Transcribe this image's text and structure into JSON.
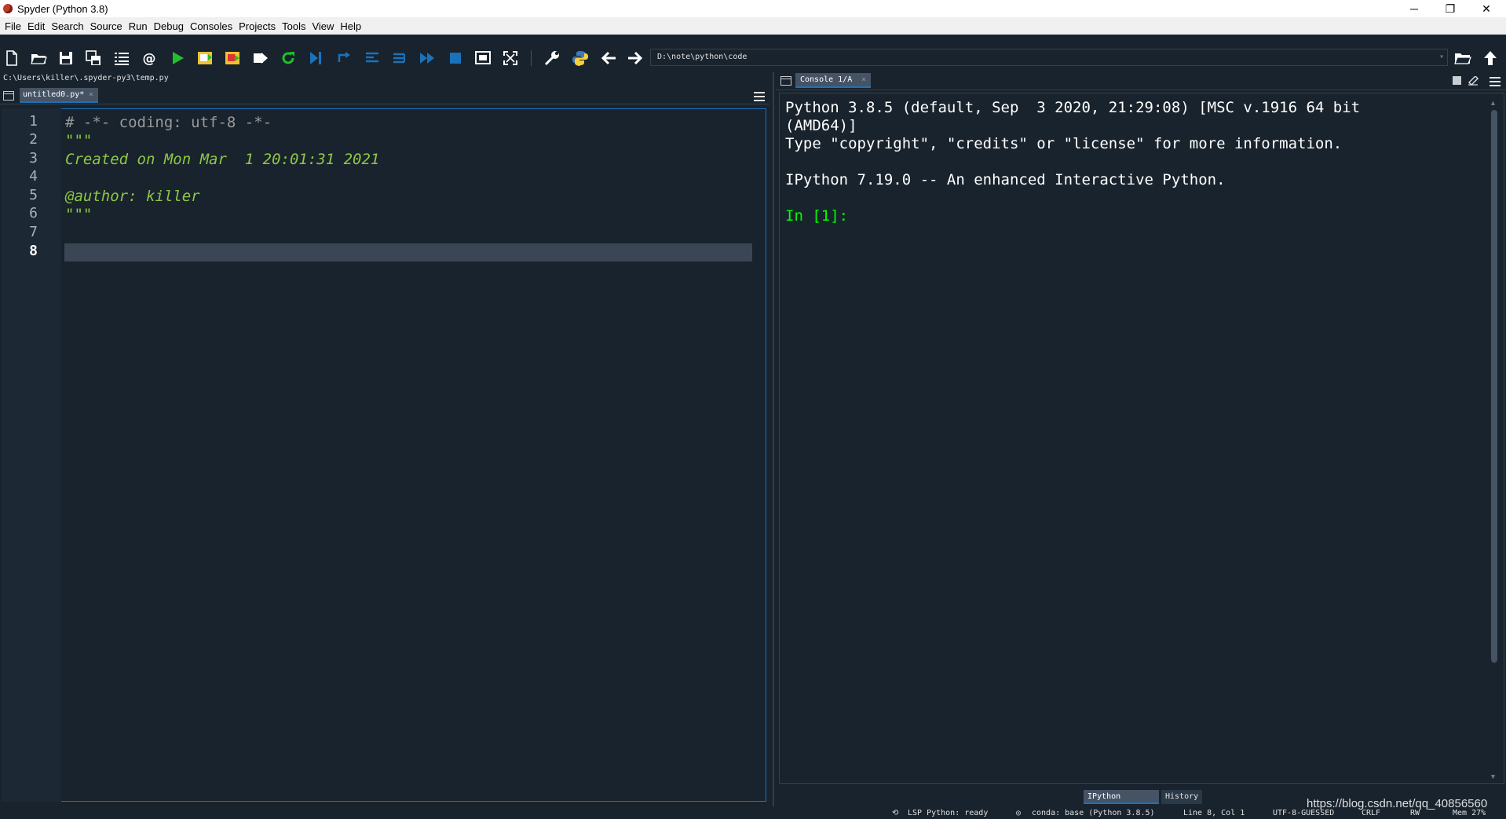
{
  "window": {
    "title": "Spyder (Python 3.8)",
    "minimize": "─",
    "restore": "❐",
    "close": "✕"
  },
  "menu": [
    "File",
    "Edit",
    "Search",
    "Source",
    "Run",
    "Debug",
    "Consoles",
    "Projects",
    "Tools",
    "View",
    "Help"
  ],
  "toolbar": {
    "working_dir": "D:\\note\\python\\code"
  },
  "editor": {
    "file_path": "C:\\Users\\killer\\.spyder-py3\\temp.py",
    "tab_label": "untitled0.py*",
    "tab_close": "×",
    "current_line": 8,
    "lines": [
      {
        "no": "1",
        "text": "# -*- coding: utf-8 -*-",
        "style": "cmt"
      },
      {
        "no": "2",
        "text": "\"\"\"",
        "style": "doc"
      },
      {
        "no": "3",
        "text": "Created on Mon Mar  1 20:01:31 2021",
        "style": "doc"
      },
      {
        "no": "4",
        "text": "",
        "style": "doc"
      },
      {
        "no": "5",
        "text": "@author: killer",
        "style": "doc"
      },
      {
        "no": "6",
        "text": "\"\"\"",
        "style": "doc"
      },
      {
        "no": "7",
        "text": "",
        "style": "cmt"
      },
      {
        "no": "8",
        "text": "",
        "style": "cmt"
      }
    ]
  },
  "console": {
    "tab_label": "Console 1/A",
    "tab_close": "×",
    "line1": "Python 3.8.5 (default, Sep  3 2020, 21:29:08) [MSC v.1916 64 bit",
    "line2": "(AMD64)]",
    "line3": "Type \"copyright\", \"credits\" or \"license\" for more information.",
    "line4": "IPython 7.19.0 -- An enhanced Interactive Python.",
    "prompt": "In [1]:",
    "bottom_tabs": [
      "IPython console",
      "History"
    ]
  },
  "status": {
    "lsp": "LSP Python: ready",
    "conda": "conda: base (Python 3.8.5)",
    "position": "Line 8, Col 1",
    "encoding": "UTF-8-GUESSED",
    "eol": "CRLF",
    "perm": "RW",
    "mem": "Mem 27%"
  },
  "watermark": "https://blog.csdn.net/qq_40856560",
  "colors": {
    "background": "#19232d",
    "accent": "#1a72bb",
    "comment": "#999999",
    "docstring": "#8dc844",
    "prompt": "#00ff00"
  }
}
